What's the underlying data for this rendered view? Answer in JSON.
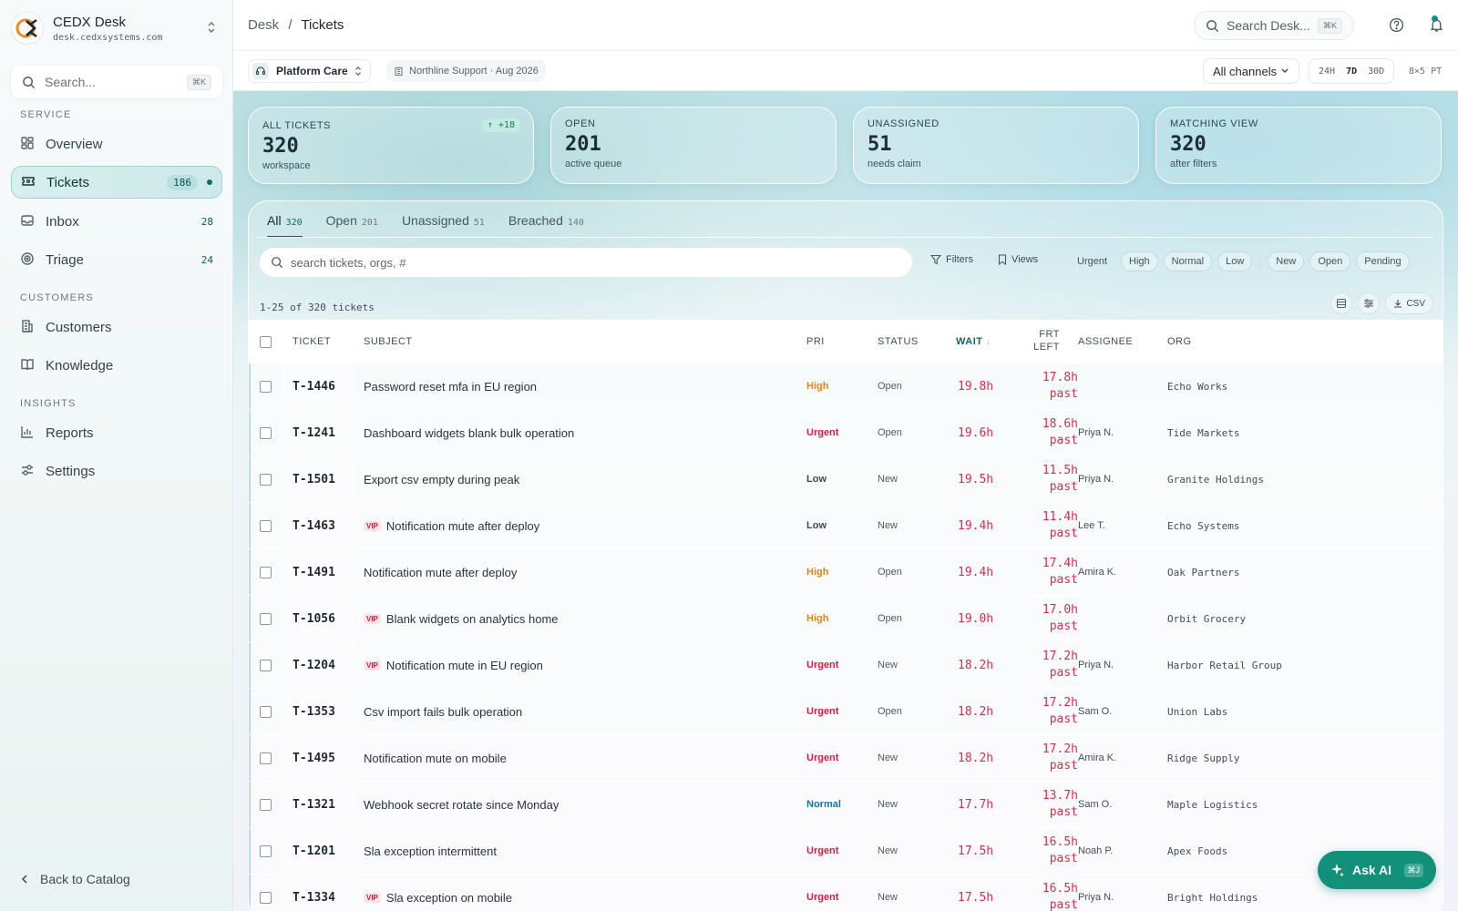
{
  "brand": {
    "name": "CEDX Desk",
    "url": "desk.cedxsystems.com"
  },
  "sidebar": {
    "search_placeholder": "Search...",
    "search_kbd": "⌘K",
    "sections": [
      {
        "label": "SERVICE"
      },
      {
        "label": "CUSTOMERS"
      },
      {
        "label": "INSIGHTS"
      }
    ],
    "items": [
      {
        "label": "Overview",
        "count": "",
        "icon": "dashboard-icon"
      },
      {
        "label": "Tickets",
        "count": "186",
        "icon": "ticket-icon",
        "active": true
      },
      {
        "label": "Inbox",
        "count": "28",
        "icon": "inbox-icon"
      },
      {
        "label": "Triage",
        "count": "24",
        "icon": "target-icon"
      },
      {
        "label": "Customers",
        "count": "",
        "icon": "building-icon"
      },
      {
        "label": "Knowledge",
        "count": "",
        "icon": "book-icon"
      },
      {
        "label": "Reports",
        "count": "",
        "icon": "chart-icon"
      },
      {
        "label": "Settings",
        "count": "",
        "icon": "sliders-icon"
      }
    ],
    "back_label": "Back to Catalog"
  },
  "header": {
    "crumb_root": "Desk",
    "crumb_sep": "/",
    "crumb_current": "Tickets",
    "search_placeholder": "Search Desk...",
    "search_kbd": "⌘K"
  },
  "toolbar": {
    "project": "Platform Care",
    "context": "Northline Support · Aug 2026",
    "channels": "All channels",
    "ranges": [
      "24H",
      "7D",
      "30D"
    ],
    "active_range": "7D",
    "schedule": "8×5 PT"
  },
  "stats": [
    {
      "label": "ALL TICKETS",
      "value": "320",
      "sub": "workspace",
      "delta": "↑ +18"
    },
    {
      "label": "OPEN",
      "value": "201",
      "sub": "active queue"
    },
    {
      "label": "UNASSIGNED",
      "value": "51",
      "sub": "needs claim"
    },
    {
      "label": "MATCHING VIEW",
      "value": "320",
      "sub": "after filters"
    }
  ],
  "tabs": [
    {
      "label": "All",
      "count": "320"
    },
    {
      "label": "Open",
      "count": "201"
    },
    {
      "label": "Unassigned",
      "count": "51"
    },
    {
      "label": "Breached",
      "count": "140"
    }
  ],
  "filters": {
    "search_placeholder": "search tickets, orgs, #",
    "filters_label": "Filters",
    "views_label": "Views",
    "priority": [
      "Urgent",
      "High",
      "Normal",
      "Low"
    ],
    "status": [
      "New",
      "Open",
      "Pending"
    ]
  },
  "list": {
    "range_text": "1-25 of 320 tickets",
    "csv_label": "CSV"
  },
  "columns": {
    "ticket": "TICKET",
    "subject": "SUBJECT",
    "pri": "PRI",
    "status": "STATUS",
    "wait": "WAIT",
    "wait_sort": "↓",
    "frt1": "FRT",
    "frt2": "LEFT",
    "assignee": "ASSIGNEE",
    "org": "ORG"
  },
  "colors": {
    "Urgent": "#d11f43",
    "High": "#d9861b",
    "Low": "#3c4a52",
    "Normal": "#1a6fb3"
  },
  "rows": [
    {
      "id": "T-1446",
      "vip": false,
      "subject": "Password reset mfa in EU region",
      "pri": "High",
      "status": "Open",
      "wait": "19.8h",
      "frt": "17.8h",
      "frt_note": "past",
      "assignee": "",
      "org": "Echo Works"
    },
    {
      "id": "T-1241",
      "vip": false,
      "subject": "Dashboard widgets blank bulk operation",
      "pri": "Urgent",
      "status": "Open",
      "wait": "19.6h",
      "frt": "18.6h",
      "frt_note": "past",
      "assignee": "Priya N.",
      "org": "Tide Markets"
    },
    {
      "id": "T-1501",
      "vip": false,
      "subject": "Export csv empty during peak",
      "pri": "Low",
      "status": "New",
      "wait": "19.5h",
      "frt": "11.5h",
      "frt_note": "past",
      "assignee": "Priya N.",
      "org": "Granite Holdings"
    },
    {
      "id": "T-1463",
      "vip": true,
      "subject": "Notification mute after deploy",
      "pri": "Low",
      "status": "New",
      "wait": "19.4h",
      "frt": "11.4h",
      "frt_note": "past",
      "assignee": "Lee T.",
      "org": "Echo Systems"
    },
    {
      "id": "T-1491",
      "vip": false,
      "subject": "Notification mute after deploy",
      "pri": "High",
      "status": "Open",
      "wait": "19.4h",
      "frt": "17.4h",
      "frt_note": "past",
      "assignee": "Amira K.",
      "org": "Oak Partners"
    },
    {
      "id": "T-1056",
      "vip": true,
      "subject": "Blank widgets on analytics home",
      "pri": "High",
      "status": "Open",
      "wait": "19.0h",
      "frt": "17.0h",
      "frt_note": "past",
      "assignee": "",
      "org": "Orbit Grocery"
    },
    {
      "id": "T-1204",
      "vip": true,
      "subject": "Notification mute in EU region",
      "pri": "Urgent",
      "status": "New",
      "wait": "18.2h",
      "frt": "17.2h",
      "frt_note": "past",
      "assignee": "Priya N.",
      "org": "Harbor Retail Group"
    },
    {
      "id": "T-1353",
      "vip": false,
      "subject": "Csv import fails bulk operation",
      "pri": "Urgent",
      "status": "Open",
      "wait": "18.2h",
      "frt": "17.2h",
      "frt_note": "past",
      "assignee": "Sam O.",
      "org": "Union Labs"
    },
    {
      "id": "T-1495",
      "vip": false,
      "subject": "Notification mute on mobile",
      "pri": "Urgent",
      "status": "New",
      "wait": "18.2h",
      "frt": "17.2h",
      "frt_note": "past",
      "assignee": "Amira K.",
      "org": "Ridge Supply"
    },
    {
      "id": "T-1321",
      "vip": false,
      "subject": "Webhook secret rotate since Monday",
      "pri": "Normal",
      "status": "New",
      "wait": "17.7h",
      "frt": "13.7h",
      "frt_note": "past",
      "assignee": "Sam O.",
      "org": "Maple Logistics"
    },
    {
      "id": "T-1201",
      "vip": false,
      "subject": "Sla exception intermittent",
      "pri": "Urgent",
      "status": "New",
      "wait": "17.5h",
      "frt": "16.5h",
      "frt_note": "past",
      "assignee": "Noah P.",
      "org": "Apex Foods"
    },
    {
      "id": "T-1334",
      "vip": true,
      "subject": "Sla exception on mobile",
      "pri": "Urgent",
      "status": "New",
      "wait": "17.5h",
      "frt": "16.5h",
      "frt_note": "past",
      "assignee": "Priya N.",
      "org": "Bright Holdings"
    }
  ],
  "vip_label": "VIP",
  "ask_ai": {
    "label": "Ask AI",
    "kbd": "⌘J"
  }
}
